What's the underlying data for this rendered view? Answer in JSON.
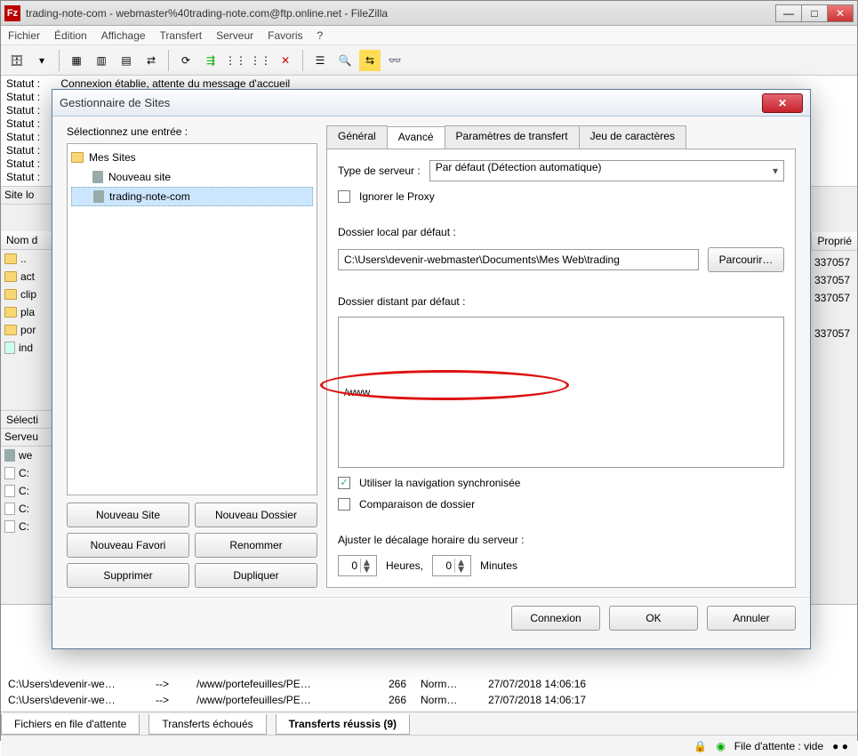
{
  "window": {
    "title": "trading-note-com - webmaster%40trading-note.com@ftp.online.net - FileZilla"
  },
  "menu": {
    "fichier": "Fichier",
    "edition": "Édition",
    "affichage": "Affichage",
    "transfert": "Transfert",
    "serveur": "Serveur",
    "favoris": "Favoris",
    "help": "?"
  },
  "status": {
    "prefix": "Statut :",
    "line1": "Connexion établie, attente du message d'accueil"
  },
  "local": {
    "site_label": "Site lo",
    "col_name": "Nom d",
    "rows": [
      "..",
      "act",
      "clip",
      "pla",
      "por",
      "ind"
    ],
    "selection": "Sélecti",
    "serveur": "Serveu",
    "server_row": "we",
    "lrows": [
      "C:",
      "C:",
      "C:",
      "C:"
    ]
  },
  "remote": {
    "col_prop": "Proprié",
    "vals": [
      "337057",
      "337057",
      "337057",
      "337057"
    ]
  },
  "queue": {
    "rows": [
      {
        "local": "C:\\Users\\devenir-we…",
        "dir": "-->",
        "remote": "/www/portefeuilles/PE…",
        "size": "266",
        "type": "Norm…",
        "time": "27/07/2018 14:06:16"
      },
      {
        "local": "C:\\Users\\devenir-we…",
        "dir": "-->",
        "remote": "/www/portefeuilles/PE…",
        "size": "266",
        "type": "Norm…",
        "time": "27/07/2018 14:06:17"
      }
    ],
    "tab_queue": "Fichiers en file d'attente",
    "tab_failed": "Transferts échoués",
    "tab_success": "Transferts réussis (9)"
  },
  "statusbar": {
    "queue_label": "File d'attente : vide"
  },
  "modal": {
    "title": "Gestionnaire de Sites",
    "select_label": "Sélectionnez une entrée :",
    "root": "Mes Sites",
    "entry1": "Nouveau site",
    "entry2": "trading-note-com",
    "btn_newsite": "Nouveau Site",
    "btn_newfolder": "Nouveau Dossier",
    "btn_newfav": "Nouveau Favori",
    "btn_rename": "Renommer",
    "btn_delete": "Supprimer",
    "btn_dup": "Dupliquer",
    "tab_general": "Général",
    "tab_advanced": "Avancé",
    "tab_transfer": "Paramètres de transfert",
    "tab_charset": "Jeu de caractères",
    "server_type_label": "Type de serveur :",
    "server_type_value": "Par défaut (Détection automatique)",
    "ignore_proxy": "Ignorer le Proxy",
    "local_dir_label": "Dossier local par défaut :",
    "local_dir_value": "C:\\Users\\devenir-webmaster\\Documents\\Mes Web\\trading",
    "browse": "Parcourir…",
    "remote_dir_label": "Dossier distant par défaut :",
    "remote_dir_value": "/www",
    "sync_nav": "Utiliser la navigation synchronisée",
    "compare": "Comparaison de dossier",
    "offset_label": "Ajuster le décalage horaire du serveur :",
    "hours_value": "0",
    "hours_label": "Heures,",
    "minutes_value": "0",
    "minutes_label": "Minutes",
    "connect": "Connexion",
    "ok": "OK",
    "cancel": "Annuler"
  }
}
